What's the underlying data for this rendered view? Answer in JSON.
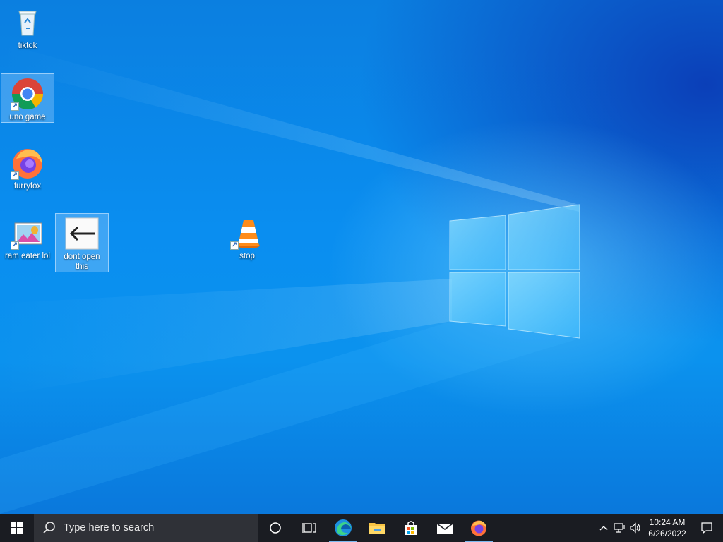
{
  "desktop": {
    "icons": [
      {
        "label": "tiktok",
        "icon": "recycle-bin-icon"
      },
      {
        "label": "uno game",
        "icon": "chrome-icon"
      },
      {
        "label": "furryfox",
        "icon": "firefox-icon"
      },
      {
        "label": "ram eater lol",
        "icon": "paint-picture-icon"
      },
      {
        "label": "dont open this",
        "icon": "arrow-left-icon"
      },
      {
        "label": "stop",
        "icon": "vlc-cone-icon"
      }
    ]
  },
  "taskbar": {
    "search_placeholder": "Type here to search",
    "pinned": [
      "cortana-icon",
      "task-view-icon",
      "edge-icon",
      "file-explorer-icon",
      "store-icon",
      "mail-icon",
      "firefox-icon"
    ]
  },
  "tray": {
    "time": "10:24 AM",
    "date": "6/26/2022"
  }
}
